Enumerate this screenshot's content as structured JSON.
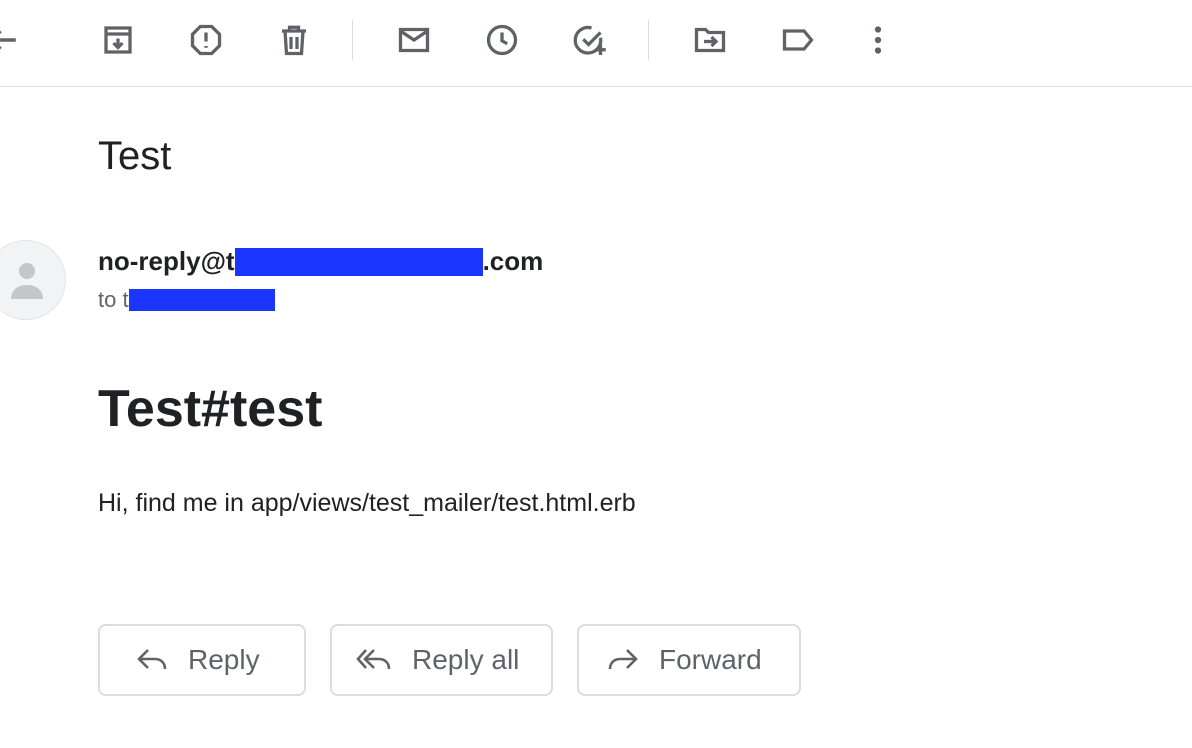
{
  "toolbar": {
    "icons": {
      "back": "arrow-left-icon",
      "archive": "archive-icon",
      "spam": "report-spam-icon",
      "delete": "trash-icon",
      "unread": "mark-unread-icon",
      "snooze": "snooze-clock-icon",
      "task": "add-to-tasks-icon",
      "move": "move-to-icon",
      "label": "label-icon",
      "more": "more-vertical-icon"
    }
  },
  "email": {
    "subject": "Test",
    "sender_prefix": "no-reply@t",
    "sender_suffix": ".com",
    "to_prefix": "to t",
    "body_heading": "Test#test",
    "body_text": "Hi, find me in app/views/test_mailer/test.html.erb"
  },
  "actions": {
    "reply": "Reply",
    "reply_all": "Reply all",
    "forward": "Forward"
  },
  "colors": {
    "redaction": "#1a35ff",
    "icon": "#5f6368",
    "text": "#202124"
  }
}
